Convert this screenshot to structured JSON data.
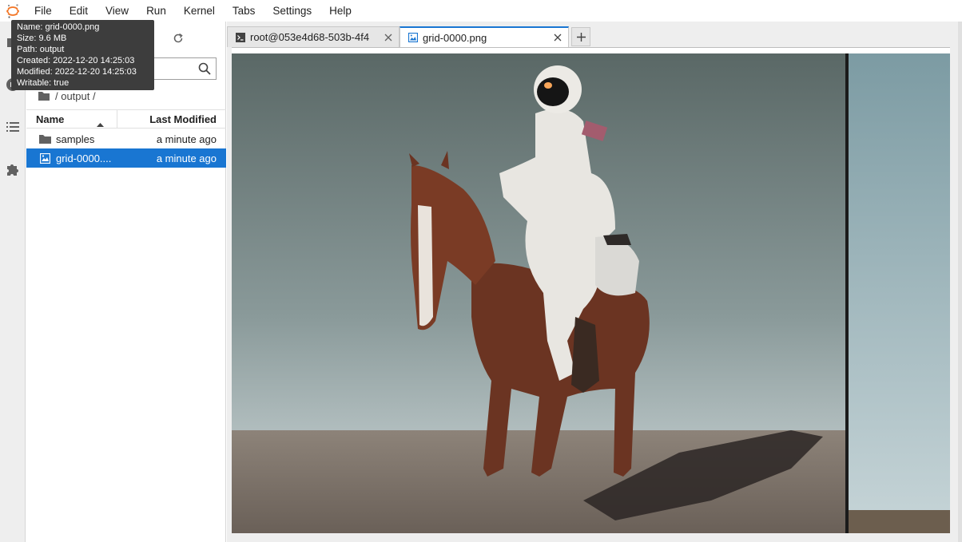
{
  "menubar": {
    "items": [
      "File",
      "Edit",
      "View",
      "Run",
      "Kernel",
      "Tabs",
      "Settings",
      "Help"
    ]
  },
  "tooltip": {
    "lines": [
      "Name: grid-0000.png",
      "Size: 9.6 MB",
      "Path: output",
      "Created: 2022-12-20 14:25:03",
      "Modified: 2022-12-20 14:25:03",
      "Writable: true"
    ]
  },
  "filebrowser": {
    "search_placeholder": "",
    "breadcrumb": "/ output /",
    "columns": {
      "name": "Name",
      "modified": "Last Modified"
    },
    "rows": [
      {
        "name": "samples",
        "modified": "a minute ago",
        "type": "folder-icon",
        "selected": false
      },
      {
        "name": "grid-0000....",
        "modified": "a minute ago",
        "type": "image-icon",
        "selected": true
      }
    ]
  },
  "tabs": [
    {
      "label": "root@053e4d68-503b-4f4",
      "icon": "terminal-icon",
      "active": false
    },
    {
      "label": "grid-0000.png",
      "icon": "image-icon",
      "active": true
    }
  ],
  "colors": {
    "accent": "#1976d2",
    "tooltip_bg": "#3d3d3d"
  }
}
